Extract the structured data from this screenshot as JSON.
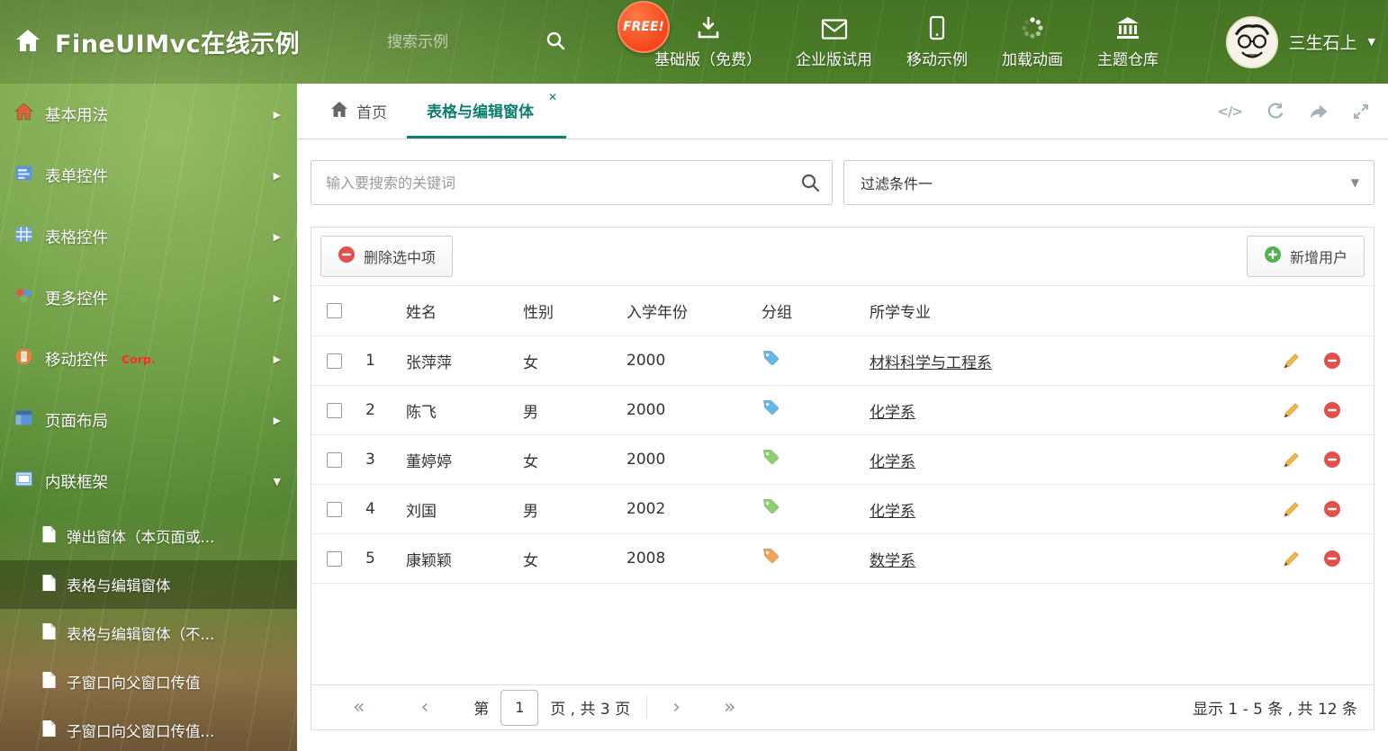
{
  "header": {
    "title": "FineUIMvc在线示例",
    "search_placeholder": "搜索示例",
    "free_badge": "FREE!",
    "nav": [
      {
        "label": "基础版（免费）"
      },
      {
        "label": "企业版试用"
      },
      {
        "label": "移动示例"
      },
      {
        "label": "加载动画"
      },
      {
        "label": "主题仓库"
      }
    ],
    "user_name": "三生石上"
  },
  "sidebar": {
    "items": [
      {
        "label": "基本用法"
      },
      {
        "label": "表单控件"
      },
      {
        "label": "表格控件"
      },
      {
        "label": "更多控件"
      },
      {
        "label": "移动控件",
        "badge": "Corp."
      },
      {
        "label": "页面布局"
      },
      {
        "label": "内联框架"
      }
    ],
    "subitems": [
      {
        "label": "弹出窗体（本页面或..."
      },
      {
        "label": "表格与编辑窗体"
      },
      {
        "label": "表格与编辑窗体（不..."
      },
      {
        "label": "子窗口向父窗口传值"
      },
      {
        "label": "子窗口向父窗口传值..."
      }
    ]
  },
  "tabs": {
    "home": "首页",
    "active": "表格与编辑窗体"
  },
  "filters": {
    "search_placeholder": "输入要搜索的关键词",
    "selected_filter": "过滤条件一"
  },
  "toolbar": {
    "delete_label": "删除选中项",
    "add_label": "新增用户"
  },
  "table": {
    "columns": [
      "姓名",
      "性别",
      "入学年份",
      "分组",
      "所学专业"
    ],
    "rows": [
      {
        "num": "1",
        "name": "张萍萍",
        "gender": "女",
        "year": "2000",
        "tag_color": "#62b8e8",
        "major": "材料科学与工程系"
      },
      {
        "num": "2",
        "name": "陈飞",
        "gender": "男",
        "year": "2000",
        "tag_color": "#62b8e8",
        "major": "化学系"
      },
      {
        "num": "3",
        "name": "董婷婷",
        "gender": "女",
        "year": "2000",
        "tag_color": "#8ecf6f",
        "major": "化学系"
      },
      {
        "num": "4",
        "name": "刘国",
        "gender": "男",
        "year": "2002",
        "tag_color": "#8ecf6f",
        "major": "化学系"
      },
      {
        "num": "5",
        "name": "康颖颖",
        "gender": "女",
        "year": "2008",
        "tag_color": "#f2a654",
        "major": "数学系"
      }
    ]
  },
  "pagination": {
    "label_page": "第",
    "current": "1",
    "label_total": "页 , 共 3 页",
    "summary": "显示 1 - 5 条 , 共 12 条"
  },
  "icons": {
    "chevron_right": "▶",
    "chevron_down": "▼",
    "caret_down": "▼",
    "close": "✕",
    "code": "</>",
    "first": "«",
    "prev": "‹",
    "next": "›",
    "last": "»"
  },
  "colors": {
    "accent": "#0c7e6f",
    "danger": "#e2504c",
    "success": "#52b152"
  }
}
